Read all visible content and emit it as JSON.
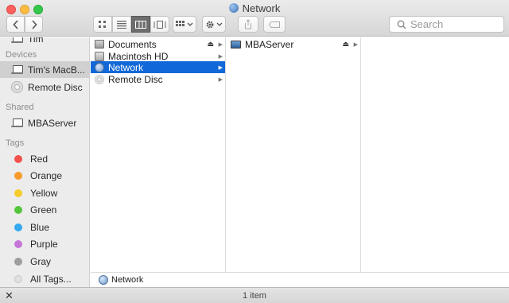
{
  "window": {
    "title": "Network"
  },
  "toolbar": {
    "back_icon": "chevron-left-icon",
    "forward_icon": "chevron-right-icon",
    "view_modes": [
      "icon-view-icon",
      "list-view-icon",
      "column-view-icon",
      "coverflow-view-icon"
    ],
    "active_view": "column",
    "search": {
      "placeholder": "Search"
    }
  },
  "sidebar": {
    "partial_item": "Tim",
    "devices_heading": "Devices",
    "devices": [
      {
        "label": "Tim's MacB...",
        "icon": "laptop-icon",
        "selected": true
      },
      {
        "label": "Remote Disc",
        "icon": "disc-icon",
        "selected": false
      }
    ],
    "shared_heading": "Shared",
    "shared": [
      {
        "label": "MBAServer",
        "icon": "laptop-icon"
      }
    ],
    "tags_heading": "Tags",
    "tags": [
      {
        "label": "Red",
        "color": "#f2514b"
      },
      {
        "label": "Orange",
        "color": "#f79a2c"
      },
      {
        "label": "Yellow",
        "color": "#f5cc29"
      },
      {
        "label": "Green",
        "color": "#54c63d"
      },
      {
        "label": "Blue",
        "color": "#36a8f0"
      },
      {
        "label": "Purple",
        "color": "#c676d8"
      },
      {
        "label": "Gray",
        "color": "#9d9d9d"
      },
      {
        "label": "All Tags...",
        "color": "#e0e0e0"
      }
    ]
  },
  "columns": {
    "col1": [
      {
        "label": "Documents",
        "icon": "documents-icon",
        "eject": true,
        "arrow": true
      },
      {
        "label": "Macintosh HD",
        "icon": "hard-drive-icon",
        "eject": false,
        "arrow": true
      },
      {
        "label": "Network",
        "icon": "network-globe-icon",
        "eject": false,
        "arrow": true,
        "selected": true
      },
      {
        "label": "Remote Disc",
        "icon": "disc-icon",
        "eject": false,
        "arrow": true
      }
    ],
    "col2": [
      {
        "label": "MBAServer",
        "icon": "server-icon",
        "eject": true,
        "arrow": true
      }
    ]
  },
  "pathbar": {
    "label": "Network"
  },
  "status": {
    "text": "1 item"
  },
  "accent_color": "#1168d8"
}
